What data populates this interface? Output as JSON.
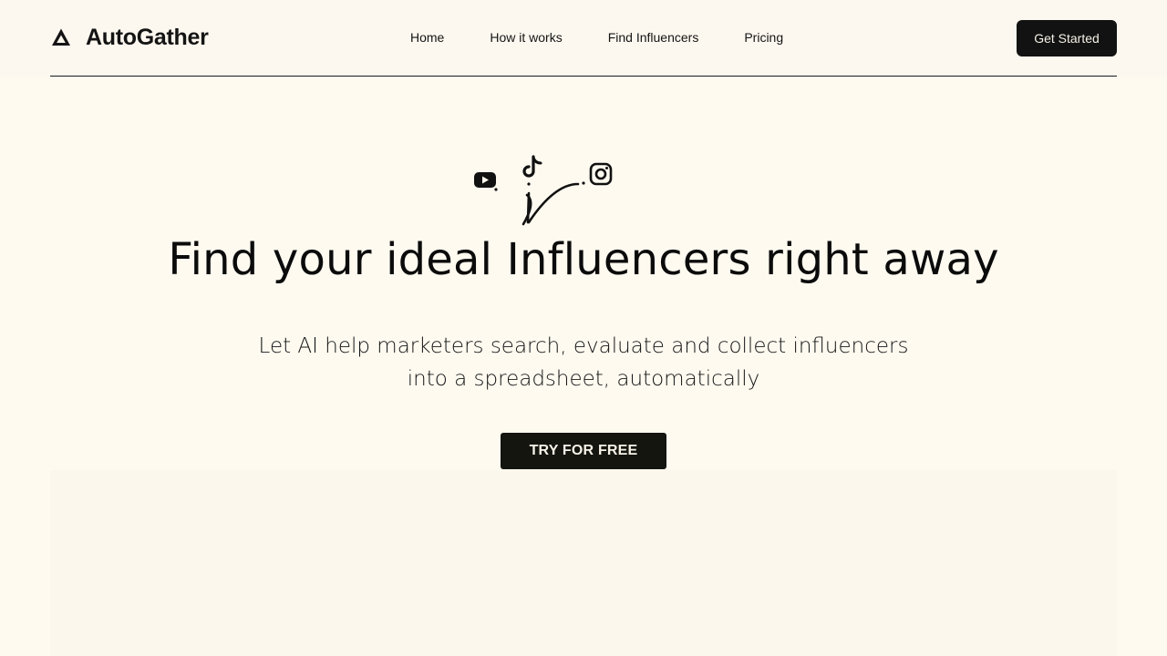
{
  "brand": {
    "name": "AutoGather"
  },
  "nav": {
    "items": [
      {
        "label": "Home"
      },
      {
        "label": "How it works"
      },
      {
        "label": "Find Influencers"
      },
      {
        "label": "Pricing"
      }
    ],
    "cta_label": "Get Started"
  },
  "hero": {
    "platforms": [
      "youtube-icon",
      "tiktok-icon",
      "instagram-icon"
    ],
    "headline": "Find your ideal Influencers right away",
    "subheadline": "Let AI help marketers search, evaluate and collect influencers into a spreadsheet, automatically",
    "cta_label": "TRY FOR FREE"
  },
  "colors": {
    "background": "#fefaf0",
    "ink": "#121212",
    "button_text": "#f6f2e8"
  }
}
